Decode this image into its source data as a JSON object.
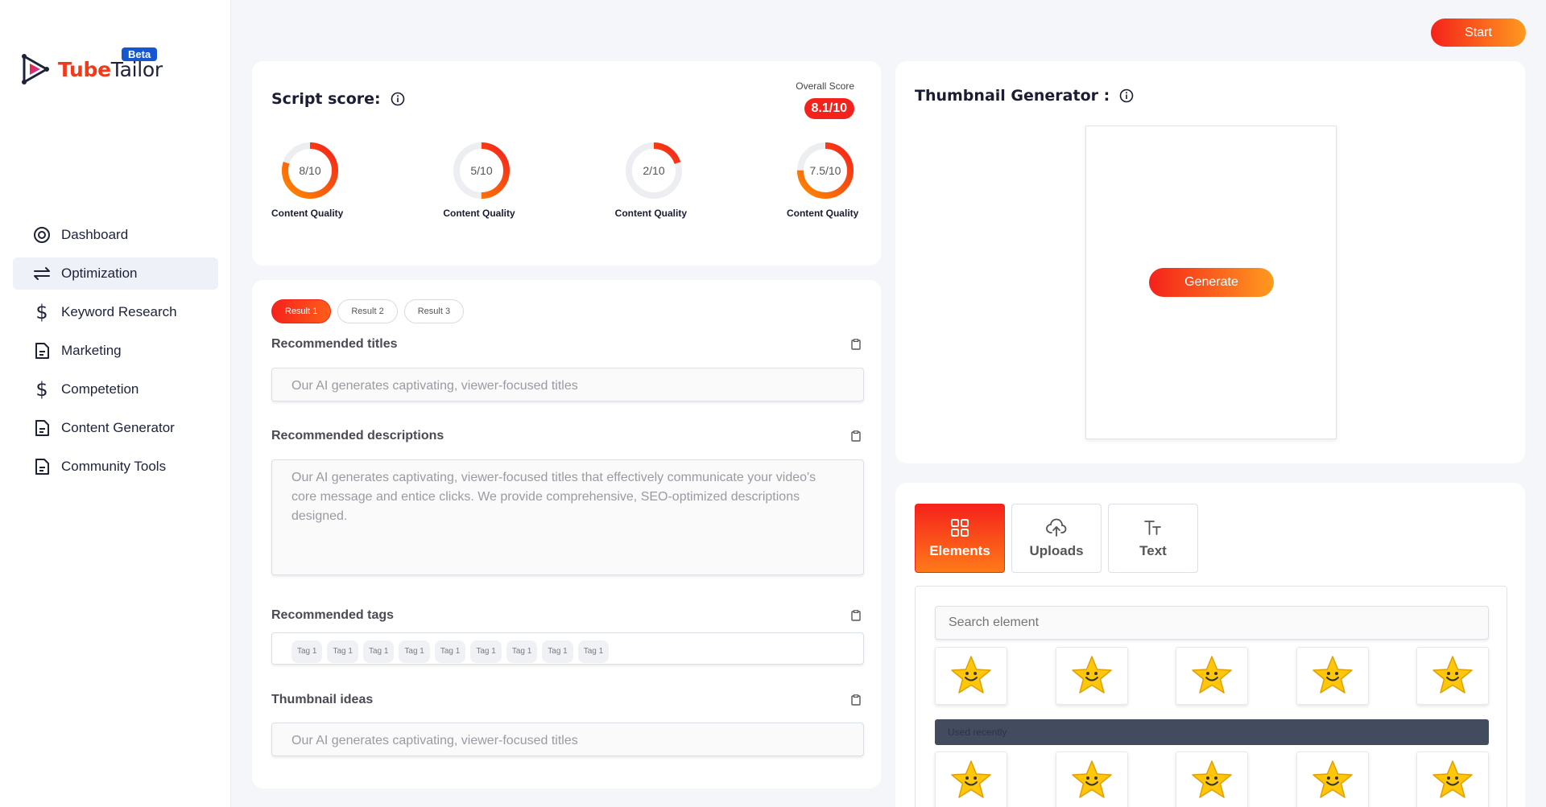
{
  "brand": {
    "name_part1": "Tube",
    "name_part2": "Tailor",
    "badge": "Beta"
  },
  "sidebar": {
    "items": [
      {
        "label": "Dashboard",
        "icon": "dashboard-icon"
      },
      {
        "label": "Optimization",
        "icon": "arrows-icon"
      },
      {
        "label": "Keyword Research",
        "icon": "dollar-icon"
      },
      {
        "label": "Marketing",
        "icon": "document-icon"
      },
      {
        "label": "Competetion",
        "icon": "dollar-icon"
      },
      {
        "label": "Content Generator",
        "icon": "document-icon"
      },
      {
        "label": "Community Tools",
        "icon": "document-icon"
      }
    ]
  },
  "header": {
    "start_label": "Start"
  },
  "score": {
    "title": "Script score:",
    "overall_label": "Overall Score",
    "overall_value": "8.1/10",
    "gauges": [
      {
        "text": "8/10",
        "value": 8,
        "label": "Content Quality"
      },
      {
        "text": "5/10",
        "value": 5,
        "label": "Content Quality"
      },
      {
        "text": "2/10",
        "value": 2,
        "label": "Content Quality"
      },
      {
        "text": "7.5/10",
        "value": 7.5,
        "label": "Content Quality"
      }
    ]
  },
  "results": {
    "tabs": [
      "Result 1",
      "Result 2",
      "Result 3"
    ],
    "titles_label": "Recommended titles",
    "titles_placeholder": "Our AI generates captivating, viewer-focused titles",
    "descriptions_label": "Recommended descriptions",
    "descriptions_placeholder": "Our AI generates captivating, viewer-focused titles that effectively communicate your video's core message and entice clicks.  We provide comprehensive, SEO-optimized descriptions designed.",
    "tags_label": "Recommended tags",
    "tags": [
      "Tag 1",
      "Tag 1",
      "Tag 1",
      "Tag 1",
      "Tag 1",
      "Tag 1",
      "Tag 1",
      "Tag 1",
      "Tag 1"
    ],
    "ideas_label": "Thumbnail ideas",
    "ideas_placeholder": "Our AI generates captivating, viewer-focused titles"
  },
  "thumbnail": {
    "title": "Thumbnail Generator :",
    "generate_label": "Generate"
  },
  "elements": {
    "tabs": [
      {
        "label": "Elements",
        "icon": "grid-icon"
      },
      {
        "label": "Uploads",
        "icon": "cloud-upload-icon"
      },
      {
        "label": "Text",
        "icon": "text-icon"
      }
    ],
    "search_placeholder": "Search element",
    "used_recently": "Used recently"
  },
  "colors": {
    "accent_start": "#f5221b",
    "accent_end": "#ff9a1f",
    "brand_blue": "#1556d1"
  }
}
